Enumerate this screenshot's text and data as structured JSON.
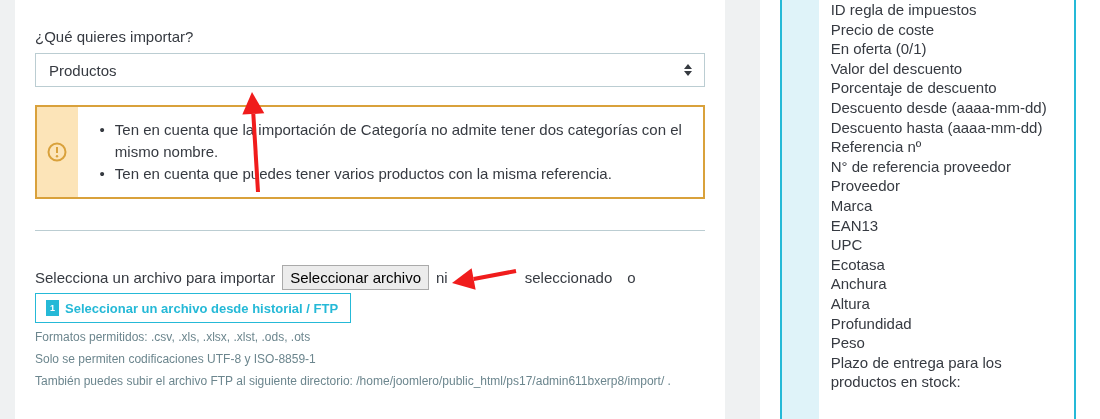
{
  "import_form": {
    "label": "¿Qué quieres importar?",
    "entity_select": {
      "value": "Productos"
    },
    "notice": {
      "items": [
        {
          "bullet": "•",
          "text": "Ten en cuenta que la importación de Categoría no admite tener dos categorías con el mismo nombre."
        },
        {
          "bullet": "•",
          "text": "Ten en cuenta que puedes tener varios productos con la misma referencia."
        }
      ]
    },
    "file_row": {
      "label": "Selecciona un archivo para importar",
      "button": "Seleccionar archivo",
      "status_parts": [
        "ni",
        "seleccionado"
      ],
      "separator": "o"
    },
    "history_button": {
      "badge": "1",
      "label": "Seleccionar un archivo desde historial / FTP"
    },
    "help": [
      "Formatos permitidos: .csv, .xls, .xlsx, .xlst, .ods, .ots",
      "Solo se permiten codificaciones UTF-8 y ISO-8859-1",
      "También puedes subir el archivo FTP al siguiente directorio: /home/joomlero/public_html/ps17/admin611bxerp8/import/ ."
    ]
  },
  "fields_panel": {
    "items": [
      "ID regla de impuestos",
      "Precio de coste",
      "En oferta (0/1)",
      "Valor del descuento",
      "Porcentaje de descuento",
      "Descuento desde (aaaa-mm-dd)",
      "Descuento hasta (aaaa-mm-dd)",
      "Referencia nº",
      "N° de referencia proveedor",
      "Proveedor",
      "Marca",
      "EAN13",
      "UPC",
      "Ecotasa",
      "Anchura",
      "Altura",
      "Profundidad",
      "Peso",
      "Plazo de entrega para los productos en stock:"
    ]
  },
  "annotations": [
    {
      "kind": "arrow"
    },
    {
      "kind": "arrow"
    }
  ]
}
